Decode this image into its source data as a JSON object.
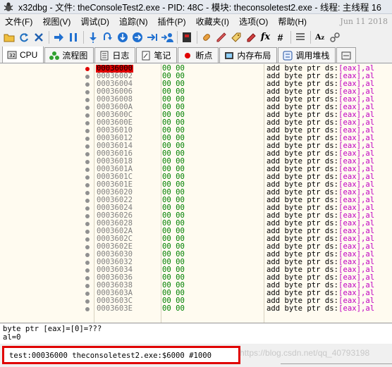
{
  "window": {
    "title": "x32dbg - 文件: theConsoleTest2.exe - PID: 48C - 模块: theconsoletest2.exe - 线程: 主线程 16"
  },
  "menu": {
    "items": [
      "文件(F)",
      "视图(V)",
      "调试(D)",
      "追踪(N)",
      "插件(P)",
      "收藏夹(I)",
      "选项(O)",
      "帮助(H)"
    ],
    "date": "Jun 11 2018"
  },
  "toolbar": {
    "icons": [
      "open-icon",
      "restart-icon",
      "close-icon",
      "run-icon",
      "pause-icon",
      "step-into-icon",
      "step-over-icon",
      "trace-into-icon",
      "trace-over-icon",
      "execute-till-return-icon",
      "run-to-user-code-icon",
      "scylla-icon",
      "patch-icon",
      "comment-icon",
      "label-icon",
      "bookmark-icon",
      "function-icon",
      "hash-icon",
      "list-icon",
      "font-icon",
      "link-icon"
    ]
  },
  "tabs": [
    {
      "label": "CPU",
      "icon": "cpu-icon",
      "active": true
    },
    {
      "label": "流程图",
      "icon": "graph-icon",
      "active": false
    },
    {
      "label": "日志",
      "icon": "log-icon",
      "active": false
    },
    {
      "label": "笔记",
      "icon": "notes-icon",
      "active": false
    },
    {
      "label": "断点",
      "icon": "breakpoint-icon",
      "active": false
    },
    {
      "label": "内存布局",
      "icon": "memory-map-icon",
      "active": false
    },
    {
      "label": "调用堆栈",
      "icon": "call-stack-icon",
      "active": false
    },
    {
      "label": "",
      "icon": "seh-icon",
      "active": false
    }
  ],
  "disasm": {
    "rows": [
      {
        "addr": "00036000",
        "bytes": "00 00",
        "mnemonic": "add byte ptr ds:",
        "operand": "[eax],al"
      },
      {
        "addr": "00036002",
        "bytes": "00 00",
        "mnemonic": "add byte ptr ds:",
        "operand": "[eax],al"
      },
      {
        "addr": "00036004",
        "bytes": "00 00",
        "mnemonic": "add byte ptr ds:",
        "operand": "[eax],al"
      },
      {
        "addr": "00036006",
        "bytes": "00 00",
        "mnemonic": "add byte ptr ds:",
        "operand": "[eax],al"
      },
      {
        "addr": "00036008",
        "bytes": "00 00",
        "mnemonic": "add byte ptr ds:",
        "operand": "[eax],al"
      },
      {
        "addr": "0003600A",
        "bytes": "00 00",
        "mnemonic": "add byte ptr ds:",
        "operand": "[eax],al"
      },
      {
        "addr": "0003600C",
        "bytes": "00 00",
        "mnemonic": "add byte ptr ds:",
        "operand": "[eax],al"
      },
      {
        "addr": "0003600E",
        "bytes": "00 00",
        "mnemonic": "add byte ptr ds:",
        "operand": "[eax],al"
      },
      {
        "addr": "00036010",
        "bytes": "00 00",
        "mnemonic": "add byte ptr ds:",
        "operand": "[eax],al"
      },
      {
        "addr": "00036012",
        "bytes": "00 00",
        "mnemonic": "add byte ptr ds:",
        "operand": "[eax],al"
      },
      {
        "addr": "00036014",
        "bytes": "00 00",
        "mnemonic": "add byte ptr ds:",
        "operand": "[eax],al"
      },
      {
        "addr": "00036016",
        "bytes": "00 00",
        "mnemonic": "add byte ptr ds:",
        "operand": "[eax],al"
      },
      {
        "addr": "00036018",
        "bytes": "00 00",
        "mnemonic": "add byte ptr ds:",
        "operand": "[eax],al"
      },
      {
        "addr": "0003601A",
        "bytes": "00 00",
        "mnemonic": "add byte ptr ds:",
        "operand": "[eax],al"
      },
      {
        "addr": "0003601C",
        "bytes": "00 00",
        "mnemonic": "add byte ptr ds:",
        "operand": "[eax],al"
      },
      {
        "addr": "0003601E",
        "bytes": "00 00",
        "mnemonic": "add byte ptr ds:",
        "operand": "[eax],al"
      },
      {
        "addr": "00036020",
        "bytes": "00 00",
        "mnemonic": "add byte ptr ds:",
        "operand": "[eax],al"
      },
      {
        "addr": "00036022",
        "bytes": "00 00",
        "mnemonic": "add byte ptr ds:",
        "operand": "[eax],al"
      },
      {
        "addr": "00036024",
        "bytes": "00 00",
        "mnemonic": "add byte ptr ds:",
        "operand": "[eax],al"
      },
      {
        "addr": "00036026",
        "bytes": "00 00",
        "mnemonic": "add byte ptr ds:",
        "operand": "[eax],al"
      },
      {
        "addr": "00036028",
        "bytes": "00 00",
        "mnemonic": "add byte ptr ds:",
        "operand": "[eax],al"
      },
      {
        "addr": "0003602A",
        "bytes": "00 00",
        "mnemonic": "add byte ptr ds:",
        "operand": "[eax],al"
      },
      {
        "addr": "0003602C",
        "bytes": "00 00",
        "mnemonic": "add byte ptr ds:",
        "operand": "[eax],al"
      },
      {
        "addr": "0003602E",
        "bytes": "00 00",
        "mnemonic": "add byte ptr ds:",
        "operand": "[eax],al"
      },
      {
        "addr": "00036030",
        "bytes": "00 00",
        "mnemonic": "add byte ptr ds:",
        "operand": "[eax],al"
      },
      {
        "addr": "00036032",
        "bytes": "00 00",
        "mnemonic": "add byte ptr ds:",
        "operand": "[eax],al"
      },
      {
        "addr": "00036034",
        "bytes": "00 00",
        "mnemonic": "add byte ptr ds:",
        "operand": "[eax],al"
      },
      {
        "addr": "00036036",
        "bytes": "00 00",
        "mnemonic": "add byte ptr ds:",
        "operand": "[eax],al"
      },
      {
        "addr": "00036038",
        "bytes": "00 00",
        "mnemonic": "add byte ptr ds:",
        "operand": "[eax],al"
      },
      {
        "addr": "0003603A",
        "bytes": "00 00",
        "mnemonic": "add byte ptr ds:",
        "operand": "[eax],al"
      },
      {
        "addr": "0003603C",
        "bytes": "00 00",
        "mnemonic": "add byte ptr ds:",
        "operand": "[eax],al"
      },
      {
        "addr": "0003603E",
        "bytes": "00 00",
        "mnemonic": "add byte ptr ds:",
        "operand": "[eax],al"
      }
    ]
  },
  "info": {
    "line1": "byte ptr [eax]=[0]=???",
    "line2": "al=0"
  },
  "status": {
    "address_line": "test:00036000 theconsoletest2.exe:$6000 #1000",
    "watermark": "https://blog.csdn.net/qq_40793198"
  },
  "colors": {
    "selection": "#e00000",
    "bytes": "#008000",
    "register": "#c000c0",
    "disasm_bg": "#fffbf0"
  }
}
